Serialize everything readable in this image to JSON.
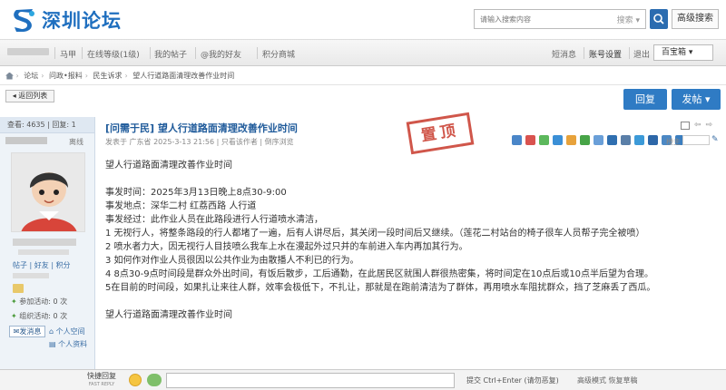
{
  "header": {
    "logo_text": "深圳论坛",
    "search_placeholder": "请输入搜索内容",
    "search_select": "搜索",
    "adv_search": "高级搜索"
  },
  "userbar": {
    "items": [
      "马甲",
      "在线等级(1级)",
      "我的帖子",
      "@我的好友",
      "积分商城"
    ],
    "notice": "短消息",
    "settings": "账号设置",
    "logout": "退出",
    "ukey": "百宝箱"
  },
  "breadcrumb": [
    "论坛",
    "问政•报料",
    "民生诉求",
    "望人行道路面清理改善作业时间"
  ],
  "actions": {
    "back": "返回列表",
    "reply": "回复",
    "post": "发帖"
  },
  "post": {
    "stats": "查看: 4635 | 回复: 1",
    "status": "离线",
    "title": "[问需于民] 望人行道路面清理改善作业时间",
    "meta": "发表于 广东省 2025-3-13 21:56 | 只看该作者 | 倒序浏览",
    "stamp": "置顶",
    "floor": "楼主",
    "body": [
      "望人行道路面清理改善作业时间",
      "",
      "事发时间：2025年3月13日晚上8点30-9:00",
      "事发地点：深华二村 红荔西路 人行道",
      "事发经过：此作业人员在此路段进行人行道喷水清洁，",
      "1 无视行人，将整条路段的行人都堵了一遍，后有人讲尽后，其关闭一段时间后又继续。（莲花二村站台的椅子很车人员帮子完全被喷）",
      "2 喷水者力大，因无视行人目技喷么我车上水在漫起外过只并的车前进入车内再加其行为。",
      "3 如何作对作业人员很因以公共作业为由散播人不利已的行为。",
      "4 8点30-9点时间段是群众外出时间，有饭后散步，工后通勤，在此居民区就围人群很热密集，将时间定在10点后或10点半后望为合理。",
      "5在目前的时间段，如果扎让来往人群，效率会极低下，不扎让，那就是在跑前清洁为了群体，再用喷水车阻扰群众，挡了芝麻丢了西瓜。",
      "",
      "望人行道路面清理改善作业时间"
    ]
  },
  "sidebar": {
    "profile_tabs": [
      "帖子",
      "好友",
      "积分"
    ],
    "activity1": "参加活动: 0 次",
    "activity2": "组织活动: 0 次",
    "send_msg": "发消息",
    "space": "个人空间",
    "profile": "个人资料"
  },
  "footer": {
    "quick_reply": "快捷回复",
    "quick_reply_en": "FAST REPLY",
    "send": "提交 Ctrl+Enter (请勿恶复)",
    "advanced": "高级模式 恢复草稿"
  }
}
